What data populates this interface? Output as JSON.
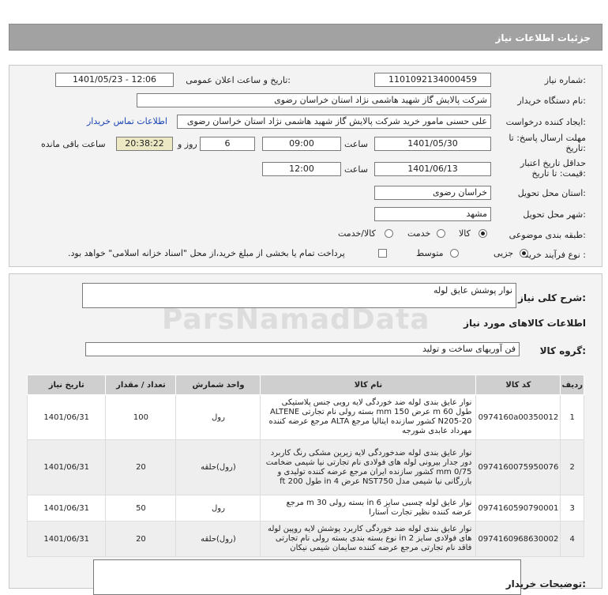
{
  "header": {
    "title": "جزئیات اطلاعات نیاز"
  },
  "form": {
    "need_number_label": "شماره نیاز:",
    "need_number": "1101092134000459",
    "announce_label": "تاریخ و ساعت اعلان عمومی:",
    "announce_value": "1401/05/23 - 12:06",
    "buyer_org_label": "نام دستگاه خریدار:",
    "buyer_org": "شرکت پالایش گاز شهید هاشمی نژاد   استان خراسان رضوی",
    "creator_label": "ایجاد کننده درخواست:",
    "creator": "علی حسنی مامور خرید شرکت پالایش گاز شهید هاشمی نژاد   استان خراسان رضوی",
    "contact_link": "اطلاعات تماس خریدار",
    "deadline_label_1": "مهلت ارسال پاسخ: تا",
    "deadline_label_2": "تاریخ:",
    "deadline_date": "1401/05/30",
    "time_label": "ساعت",
    "deadline_time": "09:00",
    "days": "6",
    "days_label": "روز و",
    "remaining_time": "20:38:22",
    "remaining_label": "ساعت باقی مانده",
    "validity_label_1": "حداقل تاریخ اعتبار",
    "validity_label_2": "قیمت: تا تاریخ:",
    "validity_date": "1401/06/13",
    "validity_time_label": "ساعت",
    "validity_time": "12:00",
    "province_label": "استان محل تحویل:",
    "province": "خراسان رضوی",
    "city_label": "شهر محل تحویل:",
    "city": "مشهد",
    "category_label": "طبقه بندی موضوعی:",
    "category_options": [
      "کالا",
      "خدمت",
      "کالا/خدمت"
    ],
    "category_selected": "کالا",
    "process_label": "نوع فرآیند خرید :",
    "process_options": [
      "جزیی",
      "متوسط"
    ],
    "process_selected": "جزیی",
    "payment_note": "پرداخت تمام یا بخشی از مبلغ خرید،از محل \"اسناد خزانه اسلامی\" خواهد بود."
  },
  "summary": {
    "label": "شرح کلی نیاز:",
    "value": "نوار پوشش عایق لوله",
    "goods_info_title": "اطلاعات کالاهای مورد نیاز",
    "group_label": "گروه کالا:",
    "group_value": "فن آوریهای ساخت و تولید"
  },
  "table": {
    "headers": [
      "ردیف",
      "کد کالا",
      "نام کالا",
      "واحد شمارش",
      "تعداد / مقدار",
      "تاریخ نیاز"
    ],
    "rows": [
      {
        "idx": "1",
        "code": "0974160a00350012",
        "name": "نوار عایق بندی لوله ضد خوردگی لایه رویی جنس پلاستیکی طول m 60 عرض mm 150 بسته رولی نام تجارتی ALTENE N205-20 کشور سازنده ایتالیا مرجع ALTA مرجع عرضه کننده مهرداد عابدی شورجه",
        "unit": "رول",
        "qty": "100",
        "date": "1401/06/31"
      },
      {
        "idx": "2",
        "code": "0974160075950076",
        "name": "نوار عایق بندی لوله ضدخوردگی لایه زیرین مشکی رنگ کاربرد دور جدار بیرونی لوله های فولادی نام تجارتی نیا شیمی ضخامت mm 0/75 کشور سازنده ایران مرجع عرضه کننده تولیدی و بازرگانی نیا شیمی مدل NST750 عرض in 4 طول ft 200",
        "unit": "(رول)حلقه",
        "qty": "20",
        "date": "1401/06/31"
      },
      {
        "idx": "3",
        "code": "0974160590790001",
        "name": "نوار عایق لوله چسبی سایز in 6 بسته رولی m 30 مرجع عرضه کننده نظیر تجارت آستارا",
        "unit": "رول",
        "qty": "50",
        "date": "1401/06/31"
      },
      {
        "idx": "4",
        "code": "0974160968630002",
        "name": "نوار عایق بندی لوله ضد خوردگی کاربرد پوشش لایه روپین لوله های فولادی سایز in 2 نوع بسته بندی بسته رولی نام تجارتی فاقد نام تجارتی مرجع عرضه کننده سایمان شیمی نیکان",
        "unit": "(رول)حلقه",
        "qty": "20",
        "date": "1401/06/31"
      }
    ]
  },
  "buyer_notes": {
    "label": "توضیحات خریدار:"
  },
  "watermark": {
    "brand": "ParsNamadData"
  }
}
